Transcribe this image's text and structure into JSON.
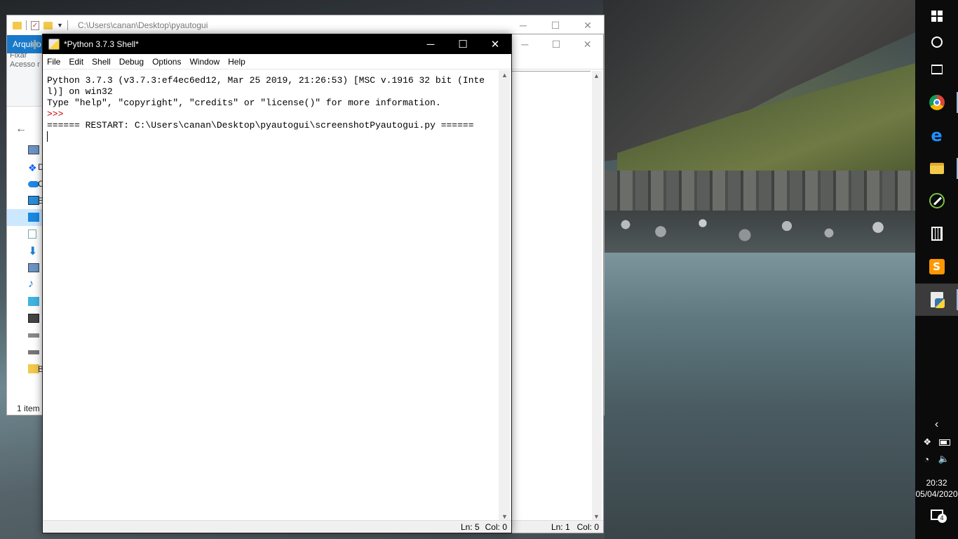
{
  "explorer": {
    "path": "C:\\Users\\canan\\Desktop\\pyautogui",
    "ribbon_tab": "Arquivo",
    "pin_label_1": "Fixar",
    "pin_label_2": "Acesso r",
    "nav_labels": [
      "D",
      "C",
      "E",
      "B"
    ],
    "status": "1 item"
  },
  "shell": {
    "title": "*Python 3.7.3 Shell*",
    "menu": [
      "File",
      "Edit",
      "Shell",
      "Debug",
      "Options",
      "Window",
      "Help"
    ],
    "lines": [
      "Python 3.7.3 (v3.7.3:ef4ec6ed12, Mar 25 2019, 21:26:53) [MSC v.1916 32 bit (Inte",
      "l)] on win32",
      "Type \"help\", \"copyright\", \"credits\" or \"license()\" for more information."
    ],
    "prompt": ">>>",
    "restart_line": "====== RESTART: C:\\Users\\canan\\Desktop\\pyautogui\\screenshotPyautogui.py ======",
    "status_ln": "Ln: 5",
    "status_col": "Col: 0"
  },
  "idle2": {
    "status_ln": "Ln: 1",
    "status_col": "Col: 0"
  },
  "taskbar": {
    "items": [
      "start",
      "cortana",
      "task-view",
      "chrome",
      "edge",
      "file-explorer",
      "pen-app",
      "calculator",
      "sublime-text",
      "python-idle"
    ],
    "tray_time": "20:32",
    "tray_date": "05/04/2020",
    "notification_count": "4"
  }
}
